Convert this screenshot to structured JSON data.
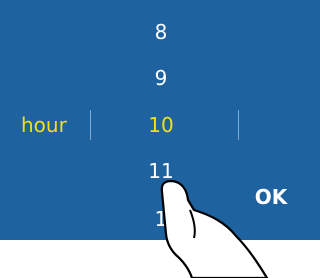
{
  "picker": {
    "unit_label": "hour",
    "values": [
      "8",
      "9",
      "10",
      "11",
      "1"
    ],
    "selected": "10"
  },
  "ok_button": {
    "label": "OK"
  },
  "colors": {
    "panel": "#1f62a0",
    "highlight": "#f2df1a",
    "text": "#ffffff"
  },
  "icons": {
    "pointer": "hand-pointer-icon"
  }
}
